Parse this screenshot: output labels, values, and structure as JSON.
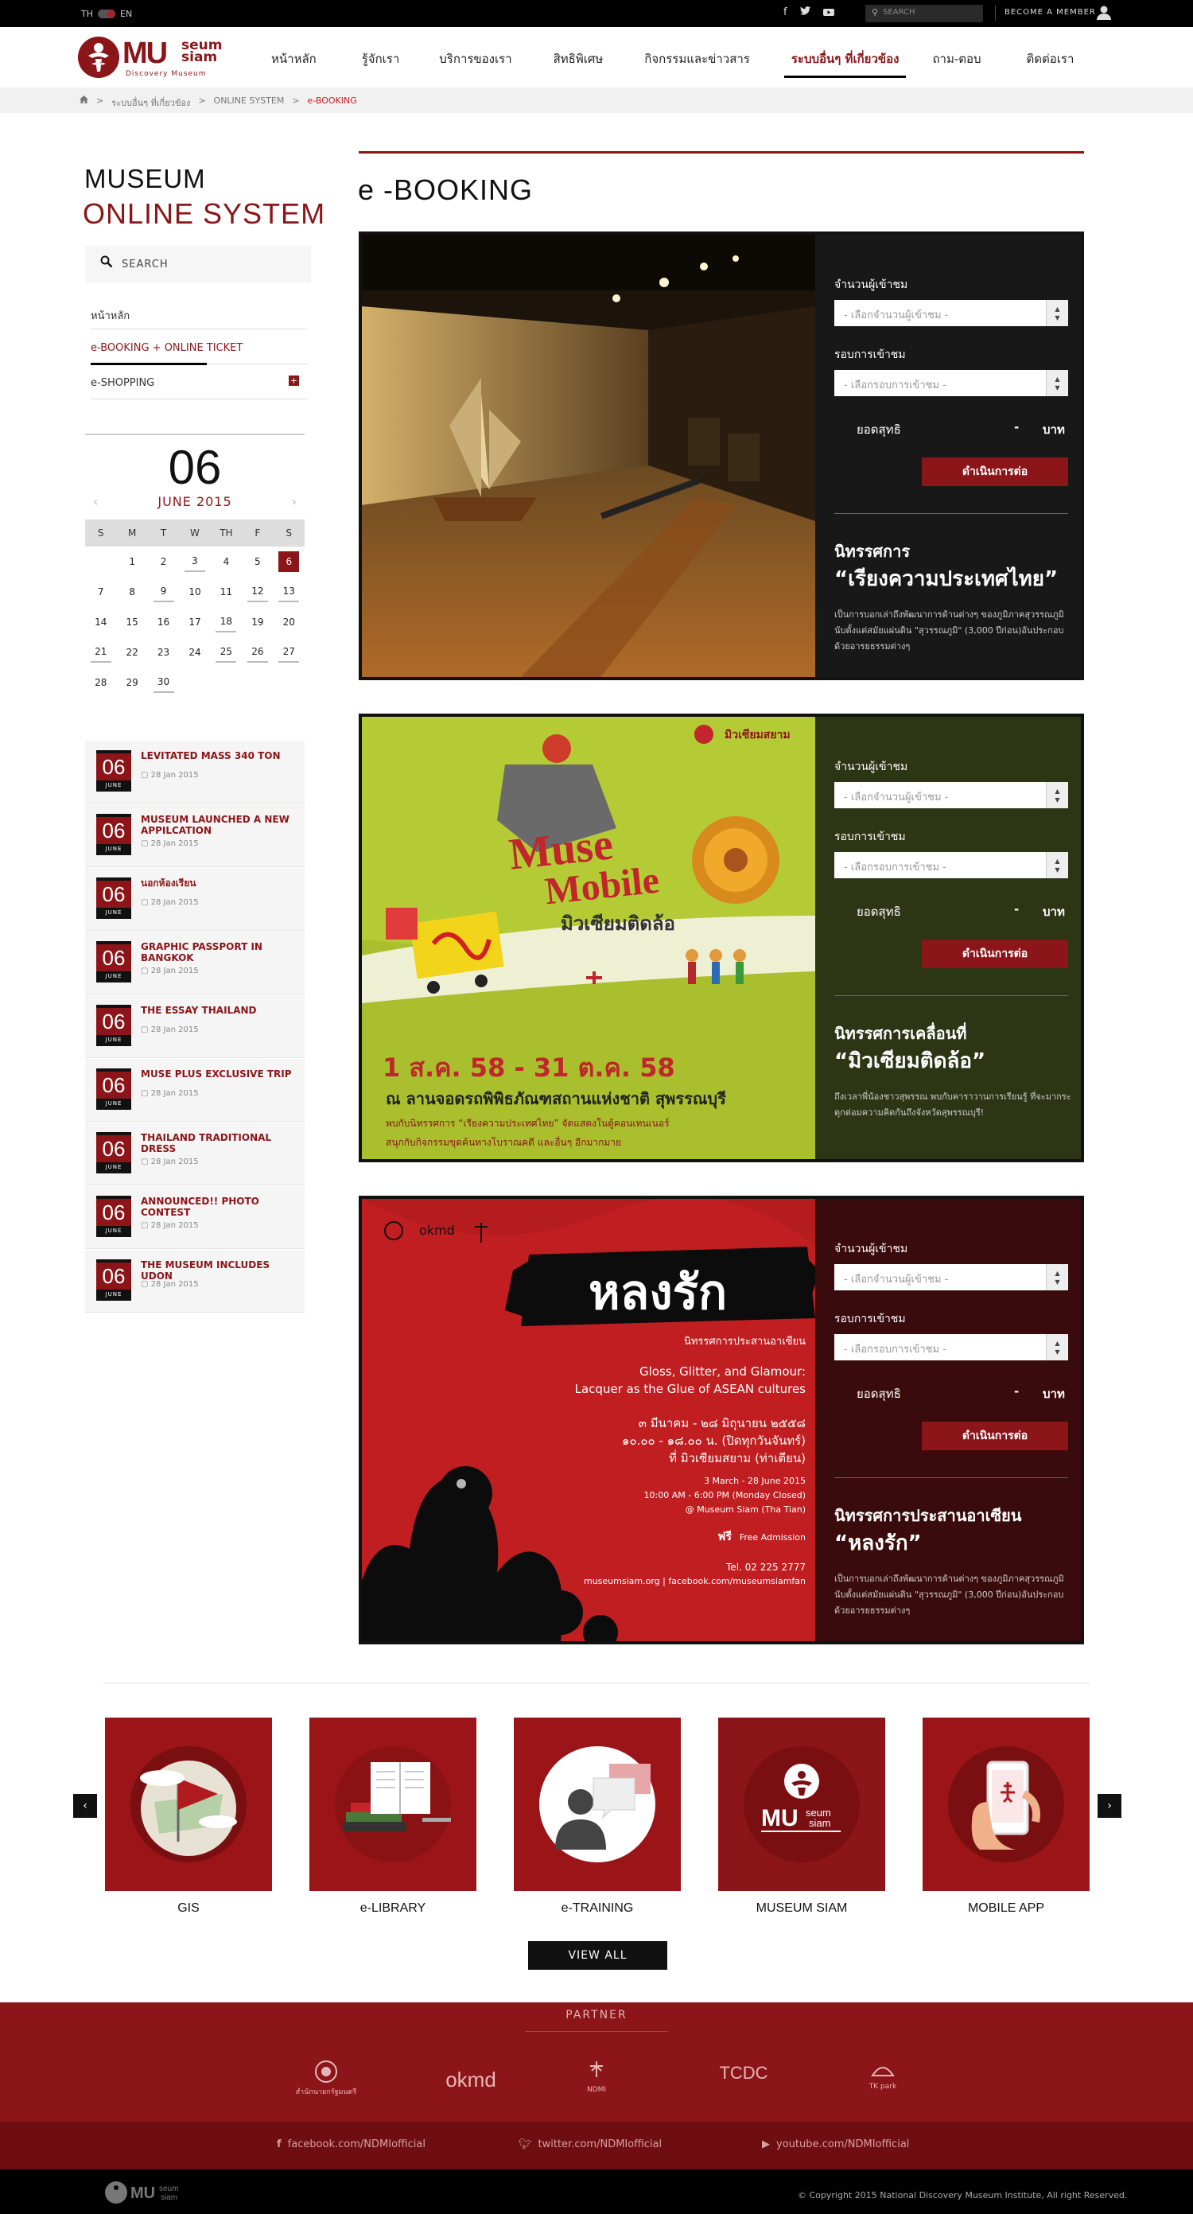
{
  "topbar": {
    "lang_th": "TH",
    "lang_en": "EN",
    "search_placeholder": "SEARCH",
    "member": "BECOME A MEMBER"
  },
  "header": {
    "logo_main": "MU",
    "logo_seum": "seum",
    "logo_siam": "siam",
    "logo_sub": "Discovery Museum",
    "nav": [
      "หน้าหลัก",
      "รู้จักเรา",
      "บริการของเรา",
      "สิทธิพิเศษ",
      "กิจกรรมและข่าวสาร",
      "ระบบอื่นๆ ที่เกี่ยวข้อง",
      "ถาม-ตอบ",
      "ติดต่อเรา"
    ],
    "nav_active": 5
  },
  "breadcrumb": {
    "items": [
      "ระบบอื่นๆ ที่เกี่ยวข้อง",
      ">",
      "ONLINE SYSTEM",
      ">"
    ],
    "current": "e-BOOKING"
  },
  "sidebar": {
    "title_line1": "MUSEUM",
    "title_line2": "ONLINE SYSTEM",
    "search_label": "SEARCH",
    "menu": [
      {
        "label": "หน้าหลัก"
      },
      {
        "label": "e-BOOKING + ONLINE TICKET"
      },
      {
        "label": "e-SHOPPING"
      }
    ]
  },
  "calendar": {
    "day": "06",
    "month": "JUNE 2015",
    "weekdays": [
      "S",
      "M",
      "T",
      "W",
      "TH",
      "F",
      "S"
    ],
    "dates": [
      "1",
      "2",
      "3",
      "4",
      "5",
      "6",
      "7",
      "8",
      "9",
      "10",
      "11",
      "12",
      "13",
      "14",
      "15",
      "16",
      "17",
      "18",
      "19",
      "20",
      "21",
      "22",
      "23",
      "24",
      "25",
      "26",
      "27",
      "28",
      "29",
      "30"
    ],
    "underlined": [
      "3",
      "9",
      "12",
      "13",
      "18",
      "21",
      "25",
      "26",
      "27",
      "30"
    ],
    "today": "6"
  },
  "events": [
    {
      "day": "06",
      "month": "JUNE",
      "title": "LEVITATED MASS 340 TON",
      "date": "28 Jan 2015"
    },
    {
      "day": "06",
      "month": "JUNE",
      "title": "MUSEUM LAUNCHED A NEW APPILCATION",
      "date": "28 Jan 2015"
    },
    {
      "day": "06",
      "month": "JUNE",
      "title": "นอกห้องเรียน",
      "date": "28 Jan 2015"
    },
    {
      "day": "06",
      "month": "JUNE",
      "title": "GRAPHIC PASSPORT IN BANGKOK",
      "date": "28 Jan 2015"
    },
    {
      "day": "06",
      "month": "JUNE",
      "title": "THE ESSAY THAILAND",
      "date": "28 Jan 2015"
    },
    {
      "day": "06",
      "month": "JUNE",
      "title": "MUSE PLUS EXCLUSIVE TRIP",
      "date": "28 Jan 2015"
    },
    {
      "day": "06",
      "month": "JUNE",
      "title": "THAILAND TRADITIONAL DRESS",
      "date": "28 Jan 2015"
    },
    {
      "day": "06",
      "month": "JUNE",
      "title": "ANNOUNCED!! PHOTO CONTEST",
      "date": "28 Jan 2015"
    },
    {
      "day": "06",
      "month": "JUNE",
      "title": "THE MUSEUM INCLUDES UDON",
      "date": "28 Jan 2015"
    }
  ],
  "main": {
    "title": "e -BOOKING",
    "form": {
      "visitors_label": "จำนวนผู้เข้าชม",
      "visitors_placeholder": "- เลือกจำนวนผู้เข้าชม -",
      "round_label": "รอบการเข้าชม",
      "round_placeholder": "- เลือกรอบการเข้าชม -",
      "net_label": "ยอดสุทธิ",
      "net_value": "-",
      "currency": "บาท",
      "submit": "ดำเนินการต่อ"
    },
    "cards": [
      {
        "exhibit_type": "นิทรรศการ",
        "exhibit_name": "“เรียงความประเทศไทย”",
        "description": "เป็นการบอกเล่าถึงพัฒนาการด้านต่างๆ ของภูมิภาคสุวรรณภูมิ นับตั้งแต่สมัยแผ่นดิน \"สุวรรณภูมิ\" (3,000 ปีก่อน)อันประกอบด้วยอารยธรรมต่างๆ",
        "panel_color": "#181818"
      },
      {
        "exhibit_type": "นิทรรศการเคลื่อนที่",
        "exhibit_name": "“มิวเซียมติดล้อ”",
        "description": "ถึงเวลาพี่น้องชาวสุพรรณ พบกับคาราวานการเรียนรู้ ที่จะมากระตุกต่อมความคิดกันถึงจังหวัดสุพรรณบุรี!",
        "panel_color": "#2c3615",
        "poster": {
          "brand": "มิวเซียมสยาม",
          "logo_muse": "Muse",
          "logo_mobile": "Mobile",
          "logo_thai": "มิวเซียมติดล้อ",
          "dates": "1 ส.ค. 58 - 31 ต.ค. 58",
          "venue": "ณ ลานจอดรถพิพิธภัณฑสถานแห่งชาติ สุพรรณบุรี",
          "note1": "พบกับนิทรรศการ “เรียงความประเทศไทย” จัดแสดงในตู้คอนเทนเนอร์",
          "note2": "สนุกกับกิจกรรมขุดค้นทางโบราณคดี และอื่นๆ อีกมากมาย"
        }
      },
      {
        "exhibit_type": "นิทรรศการประสานอาเซียน",
        "exhibit_name": "“หลงรัก”",
        "description": "เป็นการบอกเล่าถึงพัฒนาการด้านต่างๆ ของภูมิภาคสุวรรณภูมิ นับตั้งแต่สมัยแผ่นดิน \"สุวรรณภูมิ\" (3,000 ปีก่อน)อันประกอบด้วยอารยธรรมต่างๆ",
        "panel_color": "#3a0b0c",
        "poster": {
          "logo_okmd": "okmd",
          "title": "หลงรัก",
          "subtitle": "นิทรรศการประสานอาเซียน",
          "en1": "Gloss, Glitter, and Glamour:",
          "en2": "Lacquer as the Glue of ASEAN cultures",
          "th_date": "๓ มีนาคม - ๒๘ มิถุนายน ๒๕๕๘",
          "th_time": "๑๐.๐๐ - ๑๘.๐๐ น. (ปิดทุกวันจันทร์)",
          "th_place": "ที่ มิวเซียมสยาม (ท่าเตียน)",
          "en_date": "3 March - 28 June 2015",
          "en_time": "10:00 AM - 6:00 PM (Monday Closed)",
          "en_place": "@ Museum Siam (Tha Tian)",
          "free": "ฟรี",
          "free_en": "Free Admission",
          "tel": "Tel. 02 225 2777",
          "web": "museumsiam.org | facebook.com/museumsiamfan"
        }
      }
    ]
  },
  "services": {
    "items": [
      {
        "label": "GIS"
      },
      {
        "label": "e-LIBRARY"
      },
      {
        "label": "e-TRAINING"
      },
      {
        "label": "MUSEUM SIAM"
      },
      {
        "label": "MOBILE APP"
      }
    ],
    "view_all": "VIEW ALL"
  },
  "footer": {
    "partner_title": "PARTNER",
    "partners": [
      "สำนักนายกรัฐมนตรี",
      "okmd",
      "NDMI",
      "TCDC",
      "TK park"
    ],
    "social": [
      "facebook.com/NDMIofficial",
      "twitter.com/NDMIofficial",
      "youtube.com/NDMIofficial"
    ],
    "copyright": "© Copyright 2015 National Discovery Museum Institute, All right Reserved."
  },
  "colors": {
    "brand": "#8b1518",
    "dark": "#111111",
    "footer": "#8b1518"
  }
}
